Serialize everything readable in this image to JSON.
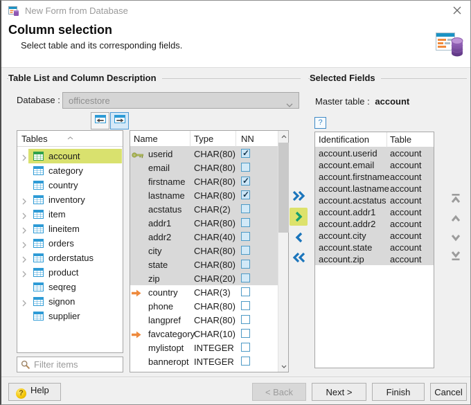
{
  "window": {
    "title": "New Form from Database"
  },
  "header": {
    "title": "Column selection",
    "subtitle": "Select table and its corresponding fields."
  },
  "left": {
    "group_title": "Table List and Column Description",
    "database_label": "Database :",
    "database_value": "officestore",
    "tables_header": "Tables",
    "filter_placeholder": "Filter items",
    "tables": [
      {
        "name": "account",
        "expandable": true,
        "selected": true,
        "icon_color": "#2fa14c"
      },
      {
        "name": "category",
        "expandable": false,
        "selected": false
      },
      {
        "name": "country",
        "expandable": false,
        "selected": false
      },
      {
        "name": "inventory",
        "expandable": true,
        "selected": false
      },
      {
        "name": "item",
        "expandable": true,
        "selected": false
      },
      {
        "name": "lineitem",
        "expandable": true,
        "selected": false
      },
      {
        "name": "orders",
        "expandable": true,
        "selected": false
      },
      {
        "name": "orderstatus",
        "expandable": true,
        "selected": false
      },
      {
        "name": "product",
        "expandable": true,
        "selected": false
      },
      {
        "name": "seqreg",
        "expandable": false,
        "selected": false
      },
      {
        "name": "signon",
        "expandable": true,
        "selected": false
      },
      {
        "name": "supplier",
        "expandable": false,
        "selected": false
      }
    ],
    "columns": {
      "headers": [
        "Name",
        "Type",
        "NN"
      ],
      "rows": [
        {
          "name": "userid",
          "type": "CHAR(80)",
          "nn": true,
          "icon": "key",
          "selected": true
        },
        {
          "name": "email",
          "type": "CHAR(80)",
          "nn": false,
          "icon": "",
          "selected": true
        },
        {
          "name": "firstname",
          "type": "CHAR(80)",
          "nn": true,
          "icon": "",
          "selected": true
        },
        {
          "name": "lastname",
          "type": "CHAR(80)",
          "nn": true,
          "icon": "",
          "selected": true
        },
        {
          "name": "acstatus",
          "type": "CHAR(2)",
          "nn": false,
          "icon": "",
          "selected": true
        },
        {
          "name": "addr1",
          "type": "CHAR(80)",
          "nn": false,
          "icon": "",
          "selected": true
        },
        {
          "name": "addr2",
          "type": "CHAR(40)",
          "nn": false,
          "icon": "",
          "selected": true
        },
        {
          "name": "city",
          "type": "CHAR(80)",
          "nn": false,
          "icon": "",
          "selected": true
        },
        {
          "name": "state",
          "type": "CHAR(80)",
          "nn": false,
          "icon": "",
          "selected": true
        },
        {
          "name": "zip",
          "type": "CHAR(20)",
          "nn": false,
          "icon": "",
          "selected": true
        },
        {
          "name": "country",
          "type": "CHAR(3)",
          "nn": false,
          "icon": "fk",
          "selected": false
        },
        {
          "name": "phone",
          "type": "CHAR(80)",
          "nn": false,
          "icon": "",
          "selected": false
        },
        {
          "name": "langpref",
          "type": "CHAR(80)",
          "nn": false,
          "icon": "",
          "selected": false
        },
        {
          "name": "favcategory",
          "type": "CHAR(10)",
          "nn": false,
          "icon": "fk",
          "selected": false
        },
        {
          "name": "mylistopt",
          "type": "INTEGER",
          "nn": false,
          "icon": "",
          "selected": false
        },
        {
          "name": "banneropt",
          "type": "INTEGER",
          "nn": false,
          "icon": "",
          "selected": false
        }
      ]
    }
  },
  "right": {
    "group_title": "Selected Fields",
    "master_table_label": "Master table :",
    "master_table_value": "account",
    "help_button_label": "?",
    "fields_table": {
      "headers": [
        "Identification",
        "Table"
      ],
      "rows": [
        {
          "identification": "account.userid",
          "table": "account"
        },
        {
          "identification": "account.email",
          "table": "account"
        },
        {
          "identification": "account.firstname",
          "table": "account"
        },
        {
          "identification": "account.lastname",
          "table": "account"
        },
        {
          "identification": "account.acstatus",
          "table": "account"
        },
        {
          "identification": "account.addr1",
          "table": "account"
        },
        {
          "identification": "account.addr2",
          "table": "account"
        },
        {
          "identification": "account.city",
          "table": "account"
        },
        {
          "identification": "account.state",
          "table": "account"
        },
        {
          "identification": "account.zip",
          "table": "account"
        }
      ]
    }
  },
  "footer": {
    "help": "Help",
    "back": "< Back",
    "next": "Next >",
    "finish": "Finish",
    "cancel": "Cancel"
  },
  "icons": {
    "titlebar": "form-database-icon",
    "header_right": "form-database-icon-large",
    "close": "close-icon",
    "toolbar": [
      "table-arrow-left-icon",
      "table-arrow-right-icon"
    ],
    "tree": [
      "chevron-right-icon",
      "table-icon"
    ],
    "column_markers": [
      "primary-key-icon",
      "foreign-key-icon"
    ],
    "transfer": [
      "move-all-right-icon",
      "move-right-icon",
      "move-left-icon",
      "move-all-left-icon"
    ],
    "order": [
      "move-to-top-icon",
      "move-up-icon",
      "move-down-icon",
      "move-to-bottom-icon"
    ],
    "filter": "magnifier-icon",
    "help": "question-ball-icon"
  },
  "colors": {
    "table_icon_blue": "#2e9bd6",
    "table_icon_green": "#2fa14c",
    "selection_yellow": "#d9e16e",
    "row_selected_gray": "#d9d9d9",
    "transfer_blue": "#1b75bb",
    "transfer_green": "#179e70",
    "fk_orange": "#ee8a3d",
    "disabled_combo_bg": "#d5d5d5"
  }
}
